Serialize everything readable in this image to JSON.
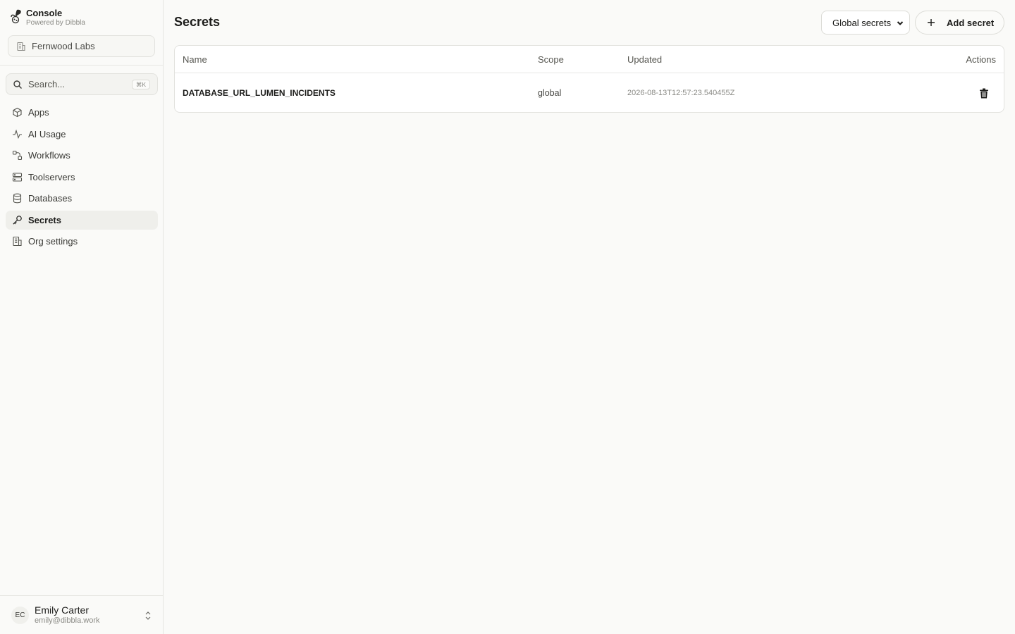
{
  "brand": {
    "title": "Console",
    "subtitle": "Powered by Dibbla"
  },
  "org": {
    "name": "Fernwood Labs"
  },
  "search": {
    "placeholder": "Search...",
    "shortcut": "⌘K"
  },
  "nav": {
    "items": [
      {
        "label": "Apps",
        "icon": "box-icon"
      },
      {
        "label": "AI Usage",
        "icon": "activity-icon"
      },
      {
        "label": "Workflows",
        "icon": "workflow-icon"
      },
      {
        "label": "Toolservers",
        "icon": "server-icon"
      },
      {
        "label": "Databases",
        "icon": "database-icon"
      },
      {
        "label": "Secrets",
        "icon": "key-icon",
        "active": true
      },
      {
        "label": "Org settings",
        "icon": "building-icon"
      }
    ]
  },
  "user": {
    "initials": "EC",
    "name": "Emily Carter",
    "email": "emily@dibbla.work"
  },
  "page": {
    "title": "Secrets",
    "scope_select": "Global secrets",
    "add_button": "Add secret"
  },
  "table": {
    "columns": [
      "Name",
      "Scope",
      "Updated",
      "Actions"
    ],
    "rows": [
      {
        "name": "DATABASE_URL_LUMEN_INCIDENTS",
        "scope": "global",
        "updated": "2026-08-13T12:57:23.540455Z"
      }
    ]
  }
}
